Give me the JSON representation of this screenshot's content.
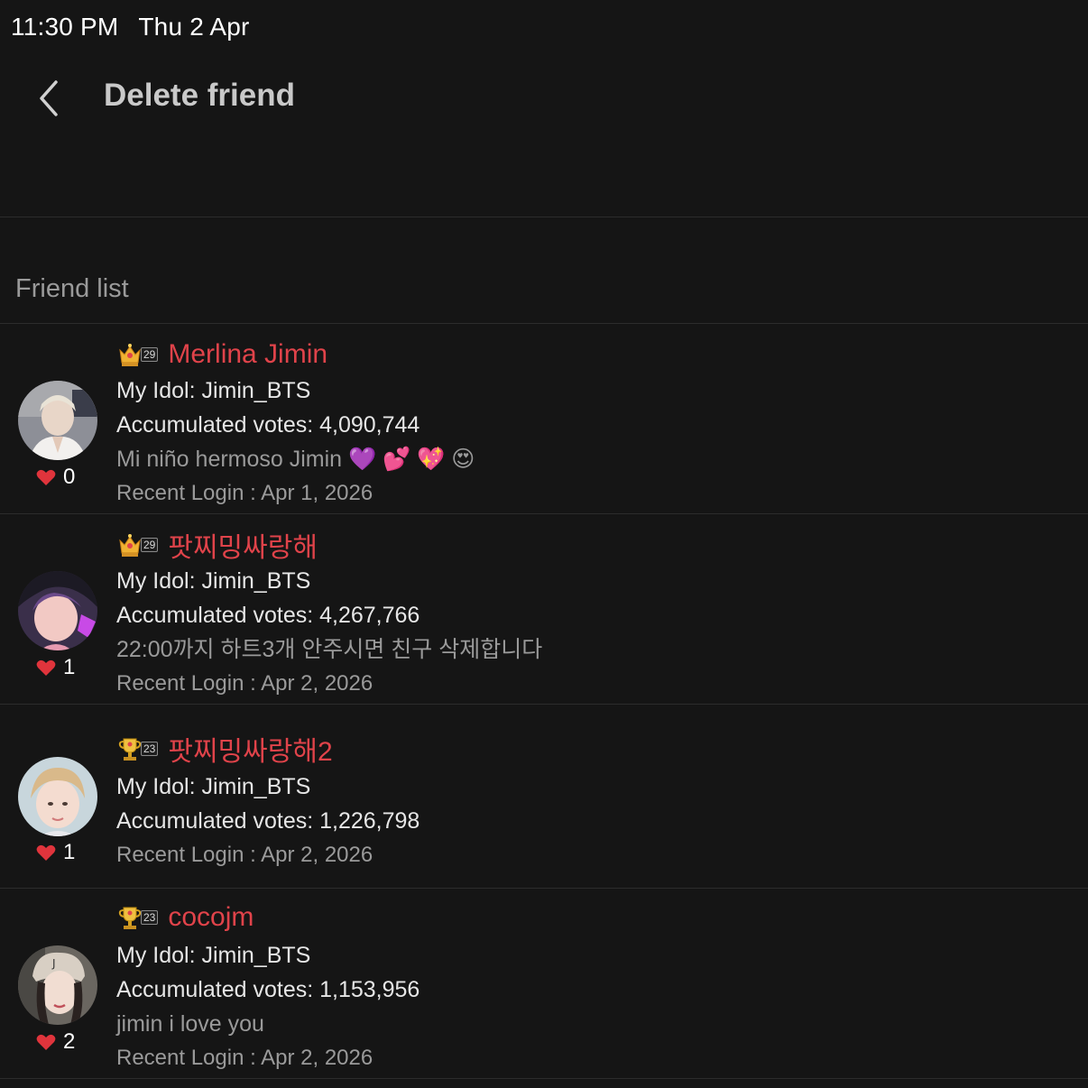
{
  "status_bar": {
    "time": "11:30 PM",
    "date": "Thu 2 Apr"
  },
  "header": {
    "title": "Delete friend",
    "back_icon": "chevron-left-icon"
  },
  "section": {
    "label": "Friend list"
  },
  "friends": [
    {
      "name": "Merlina Jimin",
      "level": "29",
      "idol": "My Idol: Jimin_BTS",
      "votes": "Accumulated votes: 4,090,744",
      "message": "Mi niño hermoso Jimin 💜 💕 💖 😍",
      "recent_login": "Recent Login : Apr 1, 2026",
      "hearts": "0"
    },
    {
      "name": "팟찌밍싸랑해",
      "level": "29",
      "idol": "My Idol: Jimin_BTS",
      "votes": "Accumulated votes: 4,267,766",
      "message": "22:00까지  하트3개 안주시면 친구 삭제합니다",
      "recent_login": "Recent Login : Apr 2, 2026",
      "hearts": "1"
    },
    {
      "name": "팟찌밍싸랑해2",
      "level": "23",
      "idol": "My Idol: Jimin_BTS",
      "votes": "Accumulated votes: 1,226,798",
      "message": "",
      "recent_login": "Recent Login : Apr 2, 2026",
      "hearts": "1"
    },
    {
      "name": "cocojm",
      "level": "23",
      "idol": "My Idol: Jimin_BTS",
      "votes": "Accumulated votes: 1,153,956",
      "message": "jimin i love you",
      "recent_login": "Recent Login : Apr 2, 2026",
      "hearts": "2"
    }
  ],
  "colors": {
    "background": "#151515",
    "name": "#e0434a",
    "heart": "#e0343c",
    "muted": "#9a9a9a"
  }
}
